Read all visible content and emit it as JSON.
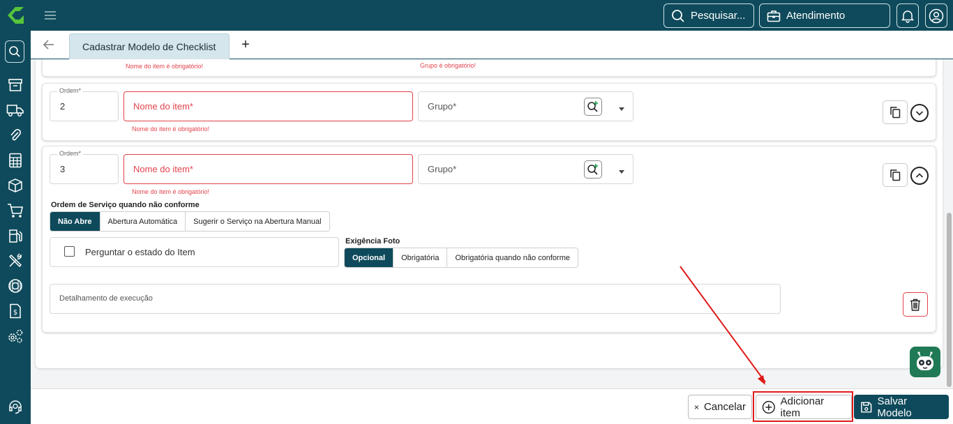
{
  "topbar": {
    "search_label": "Pesquisar...",
    "service_label": "Atendimento"
  },
  "tabs": {
    "active_tab": "Cadastrar Modelo de Checklist",
    "add_tab": "+"
  },
  "item1": {
    "name_error": "Nome do item é obrigatório!",
    "group_error": "Grupo é obrigatório!"
  },
  "item2": {
    "order_label": "Ordem*",
    "order_value": "2",
    "name_placeholder": "Nome do item*",
    "name_error": "Nome do item é obrigatório!",
    "group_placeholder": "Grupo*"
  },
  "item3": {
    "order_label": "Ordem*",
    "order_value": "3",
    "name_placeholder": "Nome do item*",
    "name_error": "Nome do item é obrigatório!",
    "group_placeholder": "Grupo*",
    "os_title": "Ordem de Serviço quando não conforme",
    "os_options": [
      "Não Abre",
      "Abertura Automática",
      "Sugerir o Serviço na Abertura Manual"
    ],
    "os_selected": "Não Abre",
    "ask_state_label": "Perguntar o estado do Item",
    "photo_title": "Exigência Foto",
    "photo_options": [
      "Opcional",
      "Obrigatória",
      "Obrigatória quando não conforme"
    ],
    "photo_selected": "Opcional",
    "detail_placeholder": "Detalhamento de execução"
  },
  "footer": {
    "cancel_label": "Cancelar",
    "add_label": "Adicionar item",
    "save_label": "Salvar Modelo"
  },
  "colors": {
    "brand": "#0e4a5b",
    "error": "#e2434b",
    "highlight": "#e01a1a",
    "bot": "#1f7a55",
    "logo": "#57c43a"
  }
}
